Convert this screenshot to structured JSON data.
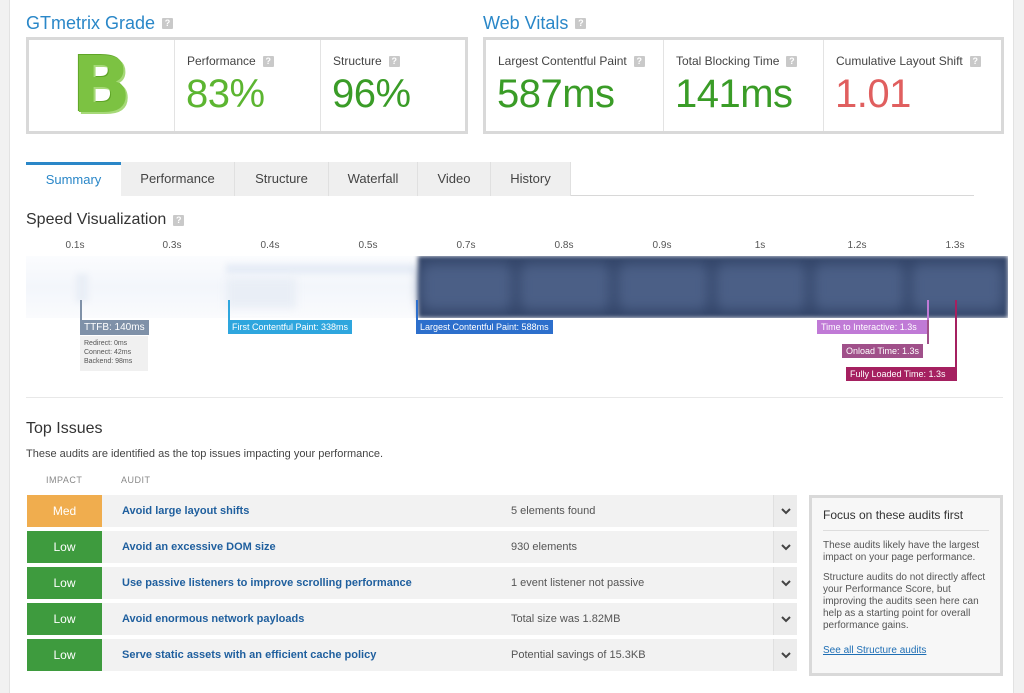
{
  "grade": {
    "title": "GTmetrix Grade",
    "help": "?",
    "letter": "B",
    "performance_label": "Performance",
    "performance_value": "83%",
    "structure_label": "Structure",
    "structure_value": "96%"
  },
  "vitals": {
    "title": "Web Vitals",
    "help": "?",
    "lcp_label": "Largest Contentful Paint",
    "lcp_value": "587ms",
    "tbt_label": "Total Blocking Time",
    "tbt_value": "141ms",
    "cls_label": "Cumulative Layout Shift",
    "cls_value": "1.01"
  },
  "tabs": [
    "Summary",
    "Performance",
    "Structure",
    "Waterfall",
    "Video",
    "History"
  ],
  "speed": {
    "title": "Speed Visualization",
    "help": "?",
    "ticks": [
      "0.1s",
      "0.3s",
      "0.4s",
      "0.5s",
      "0.7s",
      "0.8s",
      "0.9s",
      "1s",
      "1.2s",
      "1.3s"
    ],
    "ttfb": "TTFB: 140ms",
    "ttfb_details": [
      "Redirect: 0ms",
      "Connect: 42ms",
      "Backend: 98ms"
    ],
    "fcp": "First Contentful Paint: 338ms",
    "lcp": "Largest Contentful Paint: 588ms",
    "tti": "Time to Interactive: 1.3s",
    "onload": "Onload Time: 1.3s",
    "fully_loaded": "Fully Loaded Time: 1.3s"
  },
  "issues": {
    "title": "Top Issues",
    "subtitle": "These audits are identified as the top issues impacting your performance.",
    "col_impact": "IMPACT",
    "col_audit": "AUDIT",
    "rows": [
      {
        "impact": "Med",
        "audit": "Avoid large layout shifts",
        "finding": "5 elements found"
      },
      {
        "impact": "Low",
        "audit": "Avoid an excessive DOM size",
        "finding": "930 elements"
      },
      {
        "impact": "Low",
        "audit": "Use passive listeners to improve scrolling performance",
        "finding": "1 event listener not passive"
      },
      {
        "impact": "Low",
        "audit": "Avoid enormous network payloads",
        "finding": "Total size was 1.82MB"
      },
      {
        "impact": "Low",
        "audit": "Serve static assets with an efficient cache policy",
        "finding": "Potential savings of 15.3KB"
      }
    ]
  },
  "focus": {
    "title": "Focus on these audits first",
    "p1": "These audits likely have the largest impact on your page performance.",
    "p2": "Structure audits do not directly affect your Performance Score, but improving the audits seen here can help as a starting point for overall performance gains.",
    "link": "See all Structure audits"
  },
  "colors": {
    "accent": "#2a87c8",
    "grade_green": "#7cc242",
    "med": "#f0ad4e",
    "low": "#3e9b3e",
    "ttfb": "#7f91a8",
    "fcp": "#2ea6de",
    "lcp": "#2d6fcc",
    "tti": "#c07ad6",
    "onload": "#a0508a",
    "fully": "#a52060"
  },
  "icons": {
    "help": "question-mark",
    "expand": "chevron-down-icon"
  }
}
